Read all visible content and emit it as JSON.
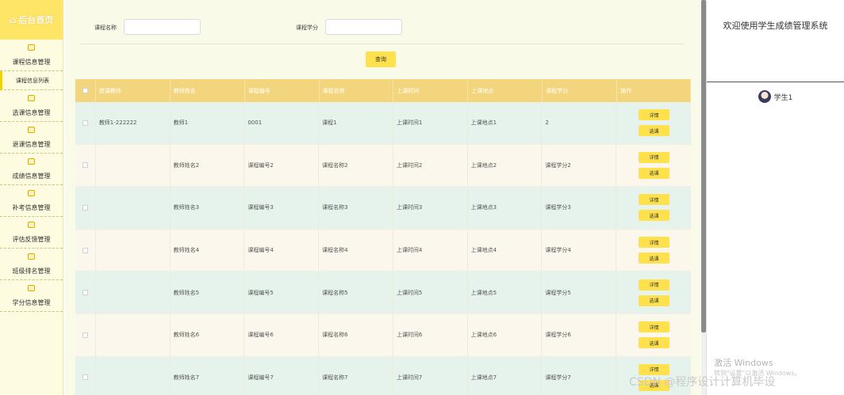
{
  "sidebar": {
    "home": "后台首页",
    "groups": [
      {
        "label": "课程信息管理",
        "sub": "课程信息列表"
      },
      {
        "label": "选课信息管理"
      },
      {
        "label": "退课信息管理"
      },
      {
        "label": "成绩信息管理"
      },
      {
        "label": "补考信息管理"
      },
      {
        "label": "评估反馈管理"
      },
      {
        "label": "班级排名管理"
      },
      {
        "label": "学分信息管理"
      }
    ]
  },
  "search": {
    "name_label": "课程名称",
    "credit_label": "课程学分",
    "name_value": "",
    "credit_value": "",
    "query_label": "查询"
  },
  "table": {
    "headers": [
      "授课教师",
      "教师姓名",
      "课程编号",
      "课程名称",
      "上课时间",
      "上课地点",
      "课程学分",
      "操作"
    ],
    "detail_label": "详情",
    "select_label": "选课",
    "rows": [
      [
        "教师1-222222",
        "教师1",
        "0001",
        "课程1",
        "上课时间1",
        "上课地点1",
        "2"
      ],
      [
        "",
        "教师姓名2",
        "课程编号2",
        "课程名称2",
        "上课时间2",
        "上课地点2",
        "课程学分2"
      ],
      [
        "",
        "教师姓名3",
        "课程编号3",
        "课程名称3",
        "上课时间3",
        "上课地点3",
        "课程学分3"
      ],
      [
        "",
        "教师姓名4",
        "课程编号4",
        "课程名称4",
        "上课时间4",
        "上课地点4",
        "课程学分4"
      ],
      [
        "",
        "教师姓名5",
        "课程编号5",
        "课程名称5",
        "上课时间5",
        "上课地点5",
        "课程学分5"
      ],
      [
        "",
        "教师姓名6",
        "课程编号6",
        "课程名称6",
        "上课时间6",
        "上课地点6",
        "课程学分6"
      ],
      [
        "",
        "教师姓名7",
        "课程编号7",
        "课程名称7",
        "上课时间7",
        "上课地点7",
        "课程学分7"
      ]
    ]
  },
  "right": {
    "welcome": "欢迎使用学生成绩管理系统",
    "user": "学生1"
  },
  "overlay": {
    "activate": "激活 Windows",
    "activate_sub": "转到\"设置\"以激活 Windows。",
    "csdn": "CSDN @程序设计计算机毕设"
  },
  "colors": {
    "accent": "#ffe14d",
    "header": "#f3d57e",
    "row_green": "#e6f3ec",
    "row_cream": "#fcf7ec"
  }
}
